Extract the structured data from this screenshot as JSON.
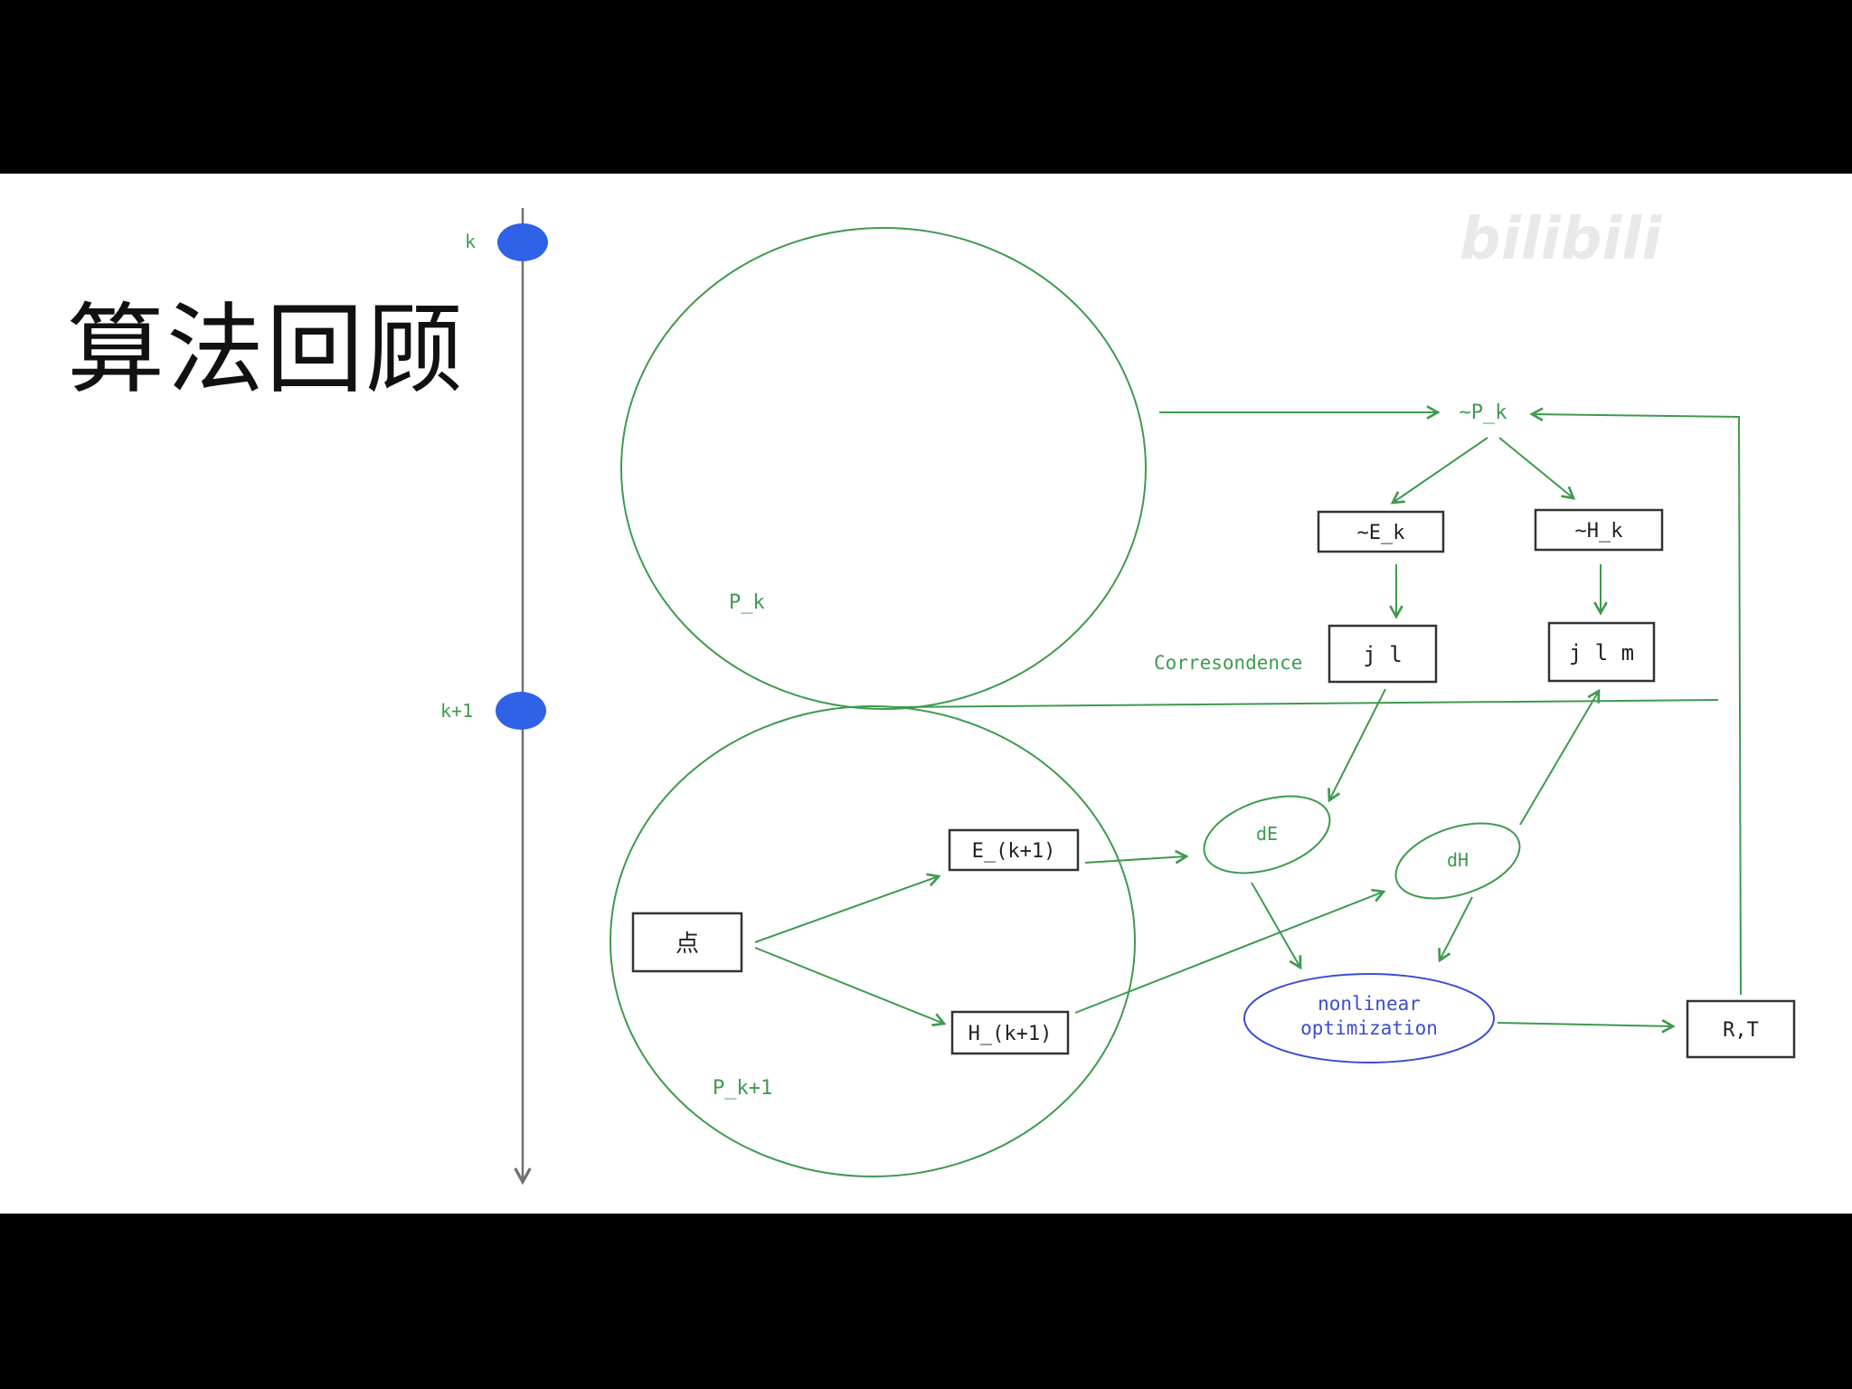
{
  "title": "算法回顾",
  "watermark": {
    "left_text": "",
    "brand": "bilibili"
  },
  "timeline": {
    "top_label": "k",
    "bottom_label": "k+1"
  },
  "frames": {
    "upper_label": "P_k",
    "lower_label": "P_k+1"
  },
  "nodes": {
    "point": "点",
    "edge_feat": "E_(k+1)",
    "plane_feat": "H_(k+1)",
    "pk_tilde": "~P_k",
    "edge_map": "~E_k",
    "plane_map": "~H_k",
    "jl": "j l",
    "jlm": "j l m",
    "dE": "dE",
    "dH": "dH",
    "nonlinear_line1": "nonlinear",
    "nonlinear_line2": "optimization",
    "rt": "R,T",
    "corr": "Corresondence"
  },
  "colors": {
    "green": "#3e9a4f",
    "blue_dot": "#2f62e6",
    "blue_text": "#3a4dd0",
    "black": "#222222",
    "axis_grey": "#707070"
  }
}
